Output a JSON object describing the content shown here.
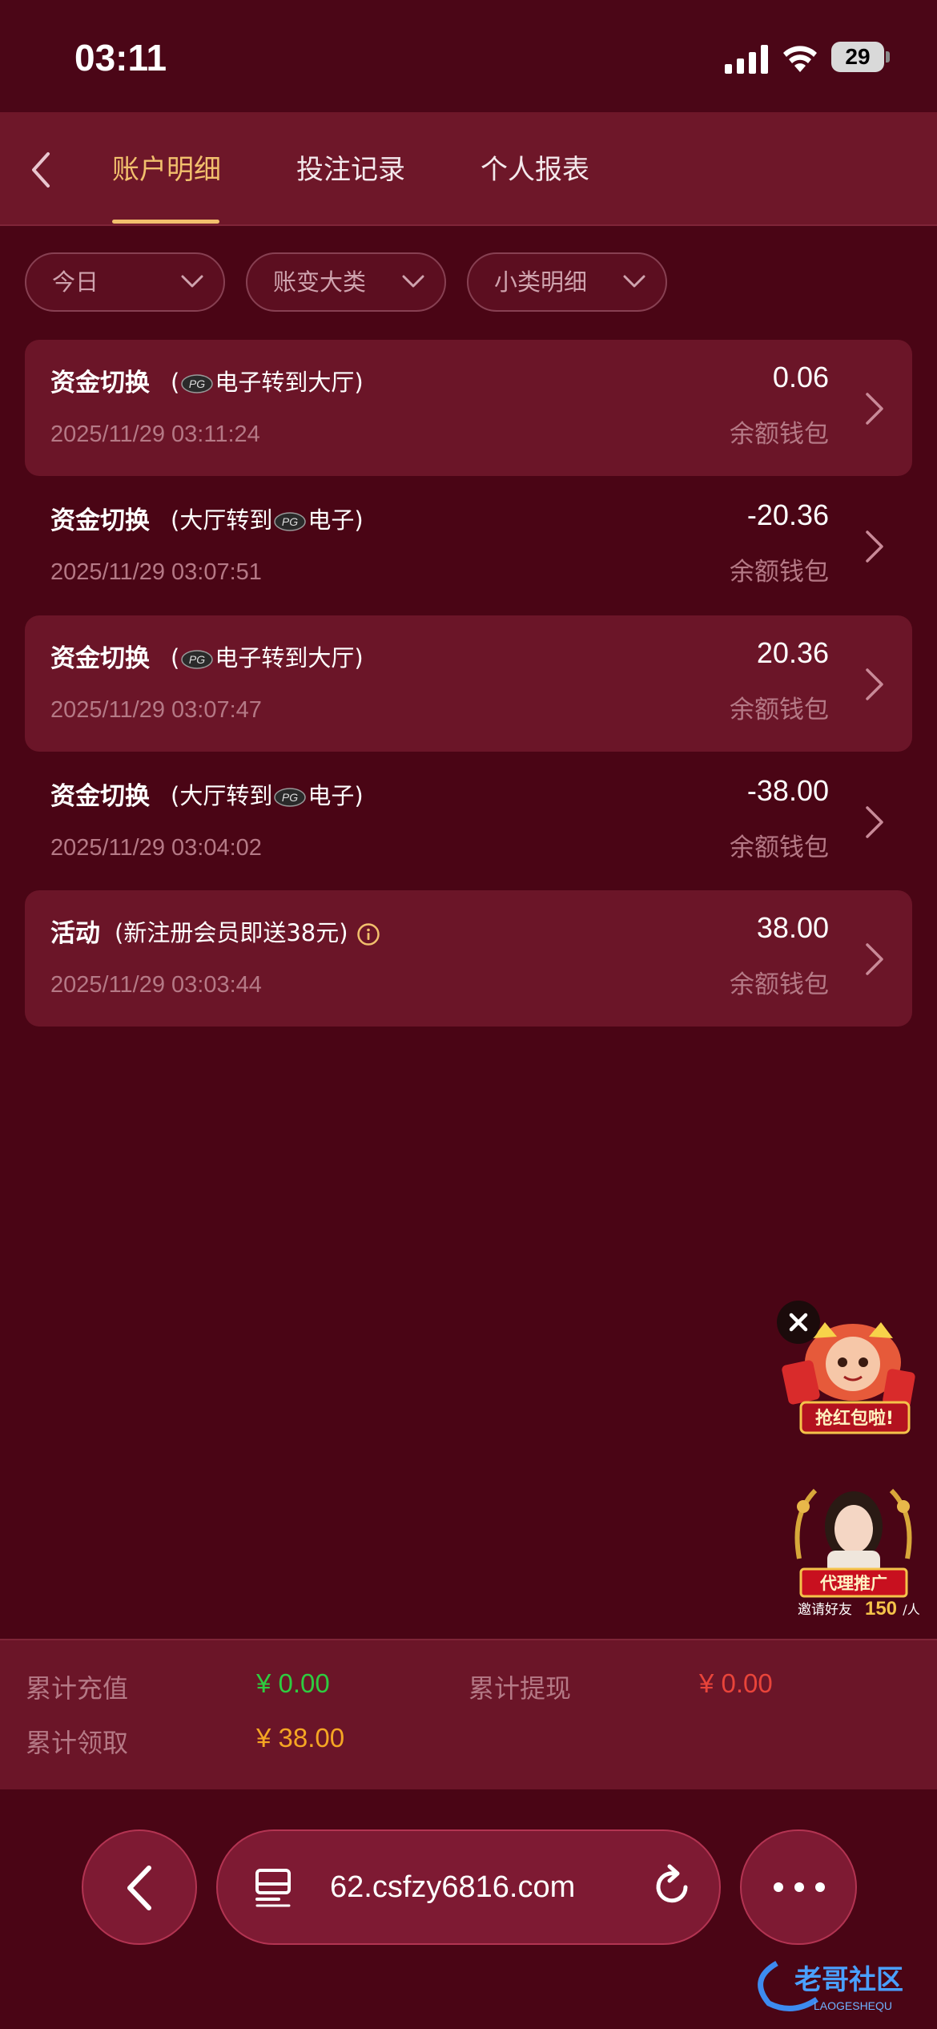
{
  "status_bar": {
    "time": "03:11",
    "battery": "29"
  },
  "header": {
    "tabs": [
      {
        "label": "账户明细",
        "active": true
      },
      {
        "label": "投注记录",
        "active": false
      },
      {
        "label": "个人报表",
        "active": false
      }
    ],
    "accent_color": "#f2c06d"
  },
  "filters": [
    {
      "label": "今日"
    },
    {
      "label": "账变大类"
    },
    {
      "label": "小类明细"
    }
  ],
  "records": [
    {
      "title": "资金切换",
      "detail_pre": "(",
      "detail_post": "电子转到大厅)",
      "has_pg_logo": "before",
      "time": "2025/11/29 03:11:24",
      "amount": "0.06",
      "wallet": "余额钱包"
    },
    {
      "title": "资金切换",
      "detail_pre": "(大厅转到",
      "detail_post": "电子)",
      "has_pg_logo": "middle",
      "time": "2025/11/29 03:07:51",
      "amount": "-20.36",
      "wallet": "余额钱包"
    },
    {
      "title": "资金切换",
      "detail_pre": "(",
      "detail_post": "电子转到大厅)",
      "has_pg_logo": "before",
      "time": "2025/11/29 03:07:47",
      "amount": "20.36",
      "wallet": "余额钱包"
    },
    {
      "title": "资金切换",
      "detail_pre": "(大厅转到",
      "detail_post": "电子)",
      "has_pg_logo": "middle",
      "time": "2025/11/29 03:04:02",
      "amount": "-38.00",
      "wallet": "余额钱包"
    },
    {
      "title": "活动",
      "detail_pre": "(新注册会员即送38元)",
      "detail_post": "",
      "has_pg_logo": "none",
      "time": "2025/11/29 03:03:44",
      "amount": "38.00",
      "wallet": "余额钱包"
    }
  ],
  "floating": {
    "redpacket_text": "抢红包啦!",
    "agent_title": "代理推广",
    "agent_sub": "邀请好友",
    "agent_amount": "150",
    "agent_unit": "/人"
  },
  "summary": {
    "recharge_label": "累计充值",
    "recharge_value": "¥ 0.00",
    "withdraw_label": "累计提现",
    "withdraw_value": "¥ 0.00",
    "claim_label": "累计领取",
    "claim_value": "¥ 38.00",
    "recharge_color": "#2ecc40",
    "withdraw_color": "#e8443a",
    "claim_color": "#f5a623"
  },
  "browser": {
    "url": "62.csfzy6816.com"
  },
  "watermark": {
    "text": "老哥社区",
    "sub": "LAOGESHEQU"
  }
}
